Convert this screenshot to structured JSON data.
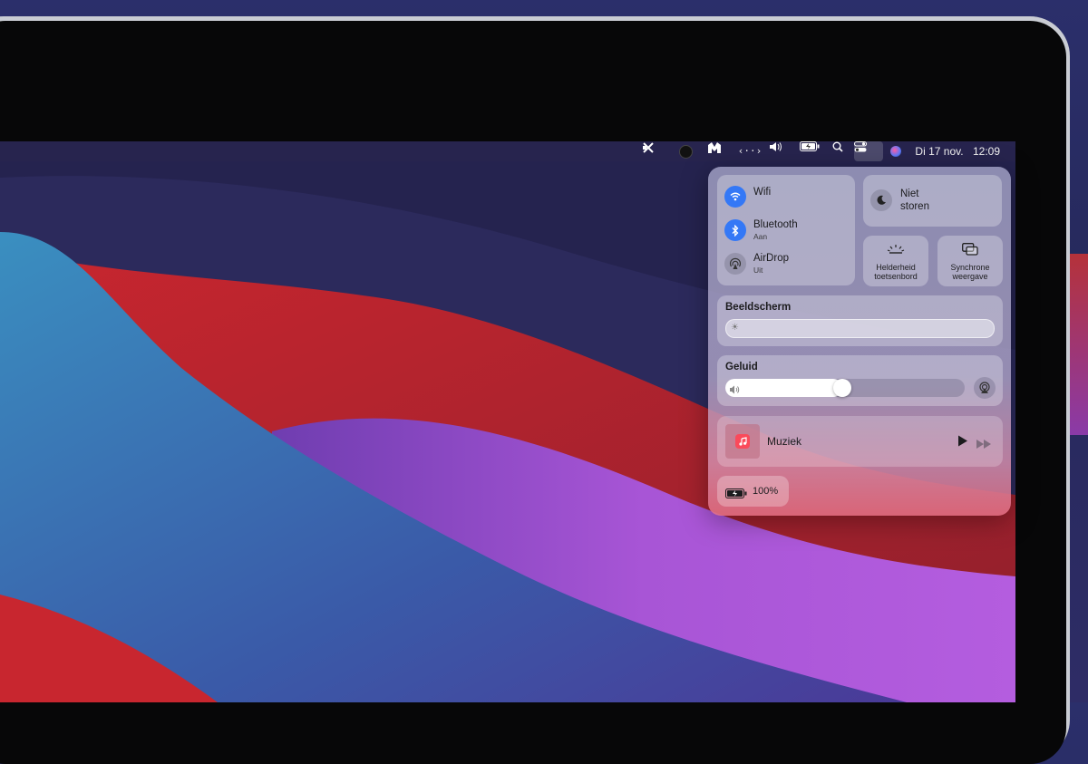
{
  "menubar": {
    "date": "Di 17 nov.",
    "time": "12:09"
  },
  "control_center": {
    "wifi": {
      "label": "Wifi"
    },
    "bluetooth": {
      "label": "Bluetooth",
      "status": "Aan"
    },
    "airdrop": {
      "label": "AirDrop",
      "status": "Uit"
    },
    "do_not_disturb": {
      "line1": "Niet",
      "line2": "storen"
    },
    "keyboard_brightness": {
      "line1": "Helderheid",
      "line2": "toetsenbord"
    },
    "screen_mirroring": {
      "line1": "Synchrone",
      "line2": "weergave"
    },
    "display": {
      "label": "Beeldscherm",
      "brightness": 0.0
    },
    "sound": {
      "label": "Geluid",
      "volume": 0.45
    },
    "music": {
      "label": "Muziek"
    },
    "battery": {
      "label": "100%"
    }
  },
  "colors": {
    "accent_blue": "#3478f6",
    "music_red": "#fa4a5b"
  },
  "icons": [
    "menu-extra-icon",
    "circle-app-icon",
    "malwarebytes-icon",
    "code-icon",
    "volume-icon",
    "battery-icon",
    "search-icon",
    "control-center-icon",
    "siri-icon",
    "wifi-icon",
    "bluetooth-icon",
    "airdrop-icon",
    "moon-icon",
    "keyboard-brightness-icon",
    "screen-mirroring-icon",
    "sun-icon",
    "speaker-icon",
    "airplay-icon",
    "music-note-icon",
    "play-icon",
    "forward-icon"
  ]
}
